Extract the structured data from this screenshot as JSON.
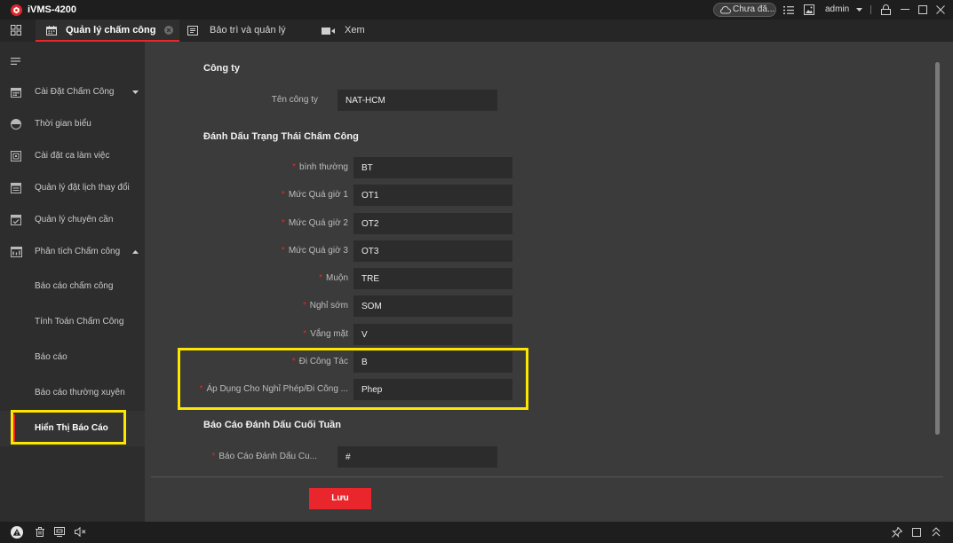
{
  "app": {
    "title": "iVMS-4200",
    "logo_icon": "ivms-logo-icon"
  },
  "titlebar": {
    "cloud_status": "Chưa đă...",
    "user": "admin",
    "icons": [
      "cloud-icon",
      "task-list-icon",
      "image-icon",
      "caret-down-icon",
      "lock-icon",
      "minimize-icon",
      "maximize-icon",
      "close-icon"
    ]
  },
  "tabs": [
    {
      "label": "Quản lý chấm công",
      "icon": "calendar-icon",
      "active": true
    },
    {
      "label": "Bảo trì và quản lý",
      "icon": "maintenance-icon",
      "active": false
    },
    {
      "label": "Xem",
      "icon": "video-icon",
      "active": false
    }
  ],
  "sidebar": {
    "menu_icon": "menu-icon",
    "items": [
      {
        "label": "Cài Đặt Chấm Công",
        "icon": "calendar-icon",
        "caret": "caret-down-icon"
      },
      {
        "label": "Thời gian biểu",
        "icon": "clock-icon"
      },
      {
        "label": "Cài đặt ca làm việc",
        "icon": "shift-icon"
      },
      {
        "label": "Quản lý đặt lịch thay đổi",
        "icon": "schedule-icon"
      },
      {
        "label": "Quản lý chuyên cần",
        "icon": "attendance-icon"
      },
      {
        "label": "Phân tích Chấm công",
        "icon": "analysis-icon",
        "caret": "caret-up-icon"
      }
    ],
    "subitems": [
      {
        "label": "Báo cáo chấm công",
        "active": false
      },
      {
        "label": "Tính Toán Chấm Công",
        "active": false
      },
      {
        "label": "Báo cáo",
        "active": false
      },
      {
        "label": "Báo cáo thường xuyên",
        "active": false
      },
      {
        "label": "Hiển Thị Báo Cáo",
        "active": true
      }
    ]
  },
  "main": {
    "required_mark": "*",
    "company": {
      "title": "Công ty",
      "name_label": "Tên công ty",
      "name_value": "NAT-HCM"
    },
    "status": {
      "title": "Đánh Dấu Trạng Thái Chấm Công",
      "fields": [
        {
          "label": "bình thường",
          "value": "BT"
        },
        {
          "label": "Mức Quá giờ 1",
          "value": "OT1"
        },
        {
          "label": "Mức Quá giờ 2",
          "value": "OT2"
        },
        {
          "label": "Mức Quá giờ 3",
          "value": "OT3"
        },
        {
          "label": "Muộn",
          "value": "TRE"
        },
        {
          "label": "Nghỉ sớm",
          "value": "SOM"
        },
        {
          "label": "Vắng mặt",
          "value": "V"
        },
        {
          "label": "Đi Công Tác",
          "value": "B"
        },
        {
          "label": "Áp Dụng Cho Nghỉ Phép/Đi Công ...",
          "value": "Phep"
        }
      ]
    },
    "weekend": {
      "title": "Báo Cáo Đánh Dấu Cuối Tuần",
      "label": "Báo Cáo Đánh Dấu Cu...",
      "value": "#"
    },
    "save_label": "Lưu"
  },
  "statusbar": {
    "left_icons": [
      "warning-icon",
      "trash-icon",
      "screen-icon",
      "speaker-mute-icon"
    ],
    "right_icons": [
      "pin-icon",
      "window-icon",
      "double-chevron-up-icon"
    ]
  },
  "colors": {
    "accent": "#e8262b",
    "highlight": "#ffe600",
    "background": "#3b3b3b",
    "sidebar": "#2d2d2d",
    "titlebar": "#1e1e1e",
    "input": "#2c2c2c"
  }
}
